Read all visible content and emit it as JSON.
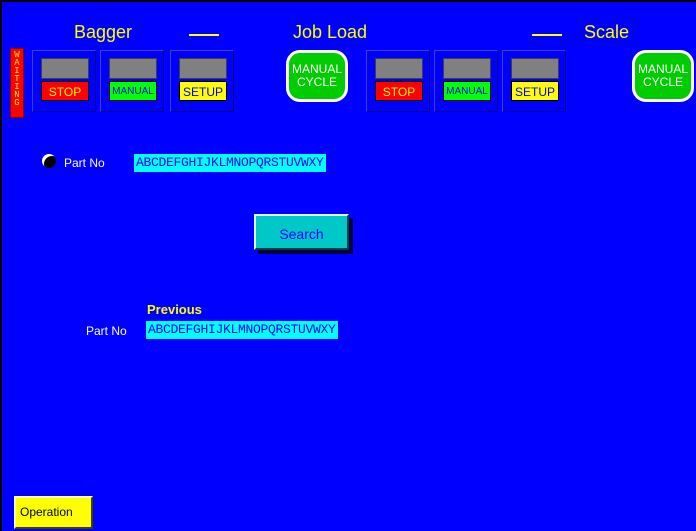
{
  "header": {
    "left_title": "Bagger",
    "center_title": "Job Load",
    "right_title": "Scale"
  },
  "status": {
    "waiting_label": "WAITING",
    "waiting_color": "#ff0000"
  },
  "bagger_controls": {
    "stop_label": "STOP",
    "manual_label": "MANUAL",
    "setup_label": "SETUP",
    "manual_cycle_line1": "MANUAL",
    "manual_cycle_line2": "CYCLE"
  },
  "scale_controls": {
    "stop_label": "STOP",
    "manual_label": "MANUAL",
    "setup_label": "SETUP",
    "manual_cycle_line1": "MANUAL",
    "manual_cycle_line2": "CYCLE"
  },
  "part_search": {
    "label": "Part No",
    "value": "ABCDEFGHIJKLMNOPQRSTUVWXY",
    "search_label": "Search"
  },
  "previous": {
    "heading": "Previous",
    "label": "Part No",
    "value": "ABCDEFGHIJKLMNOPQRSTUVWXY"
  },
  "footer": {
    "operation_label": "Operation"
  },
  "colors": {
    "background": "#0000ff",
    "header_text": "#ffff00",
    "field_bg": "#00ffff",
    "manual_cycle": "#00cc00"
  }
}
